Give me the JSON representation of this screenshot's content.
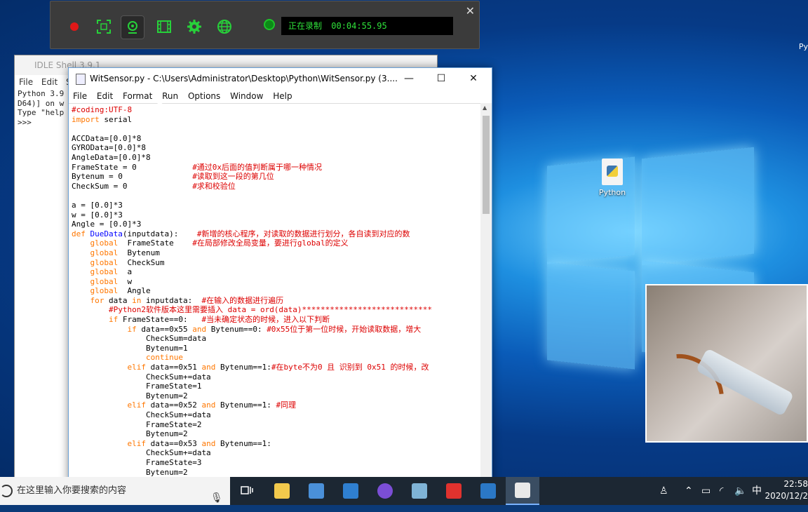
{
  "recorder": {
    "status_text": "正在录制",
    "elapsed_time": "00:04:55.95",
    "close_glyph": "✕"
  },
  "desktop": {
    "icon_label": "Python",
    "edge_label": "Py"
  },
  "idle_shell": {
    "title": "IDLE Shell 3.9.1",
    "menu": [
      "File",
      "Edit",
      "S"
    ],
    "lines": [
      "Python 3.9",
      "D64)] on w",
      "Type \"help",
      ">>>"
    ]
  },
  "editor": {
    "title": "WitSensor.py - C:\\Users\\Administrator\\Desktop\\Python\\WitSensor.py (3....",
    "controls": {
      "minimize": "—",
      "maximize": "☐",
      "close": "✕"
    },
    "menu": [
      "File",
      "Edit",
      "Format",
      "Run",
      "Options",
      "Window",
      "Help"
    ],
    "code": {
      "l1": "#coding:UTF-8",
      "l2_kw": "import",
      "l2_rest": " serial",
      "l4": "ACCData=[0.0]*8",
      "l5": "GYROData=[0.0]*8",
      "l6": "AngleData=[0.0]*8",
      "l7": "FrameState = 0            ",
      "l7_c": "#通过0x后面的值判断属于哪一种情况",
      "l8": "Bytenum = 0               ",
      "l8_c": "#读取到这一段的第几位",
      "l9": "CheckSum = 0              ",
      "l9_c": "#求和校验位",
      "l11": "a = [0.0]*3",
      "l12": "w = [0.0]*3",
      "l13": "Angle = [0.0]*3",
      "l14_kw": "def",
      "l14_fn": "DueData",
      "l14_rest": "(inputdata):    ",
      "l14_c": "#新增的核心程序，对读取的数据进行划分，各自读到对应的数",
      "g_kw": "global",
      "l15": "  FrameState    ",
      "l15_c": "#在局部修改全局变量，要进行global的定义",
      "l16": "  Bytenum",
      "l17": "  CheckSum",
      "l18": "  a",
      "l19": "  w",
      "l20": "  Angle",
      "l21_kw1": "for",
      "l21_a": " data ",
      "l21_kw2": "in",
      "l21_b": " inputdata:  ",
      "l21_c": "#在输入的数据进行遍历",
      "l22_c": "#Python2软件版本这里需要插入 data = ord(data)****************************",
      "l23_kw": "if",
      "l23_rest": " FrameState==0:   ",
      "l23_c": "#当未确定状态的时候，进入以下判断",
      "l24_kw": "if",
      "l24_a": " data==0x55 ",
      "and": "and",
      "l24_b": " Bytenum==0: ",
      "l24_c": "#0x55位于第一位时候，开始读取数据，增大",
      "l25": "CheckSum=data",
      "l26": "Bytenum=1",
      "l27_kw": "continue",
      "elif": "elif",
      "l28_a": " data==0x51 ",
      "l28_b": " Bytenum==1:",
      "l28_c": "#在byte不为0 且 识别到 0x51 的时候，改",
      "l29": "CheckSum+=data",
      "l30": "FrameState=1",
      "l31": "Bytenum=2",
      "l32_a": " data==0x52 ",
      "l32_b": " Bytenum==1: ",
      "l32_c": "#同理",
      "l33": "CheckSum+=data",
      "l34": "FrameState=2",
      "l35": "Bytenum=2",
      "l36_a": " data==0x53 ",
      "l36_b": " Bytenum==1:",
      "l37": "CheckSum+=data",
      "l38": "FrameState=3",
      "l39": "Bytenum=2"
    }
  },
  "taskbar": {
    "search_placeholder": "在这里输入你要搜索的内容",
    "ime": "中",
    "time": "22:58",
    "date": "2020/12/2"
  }
}
